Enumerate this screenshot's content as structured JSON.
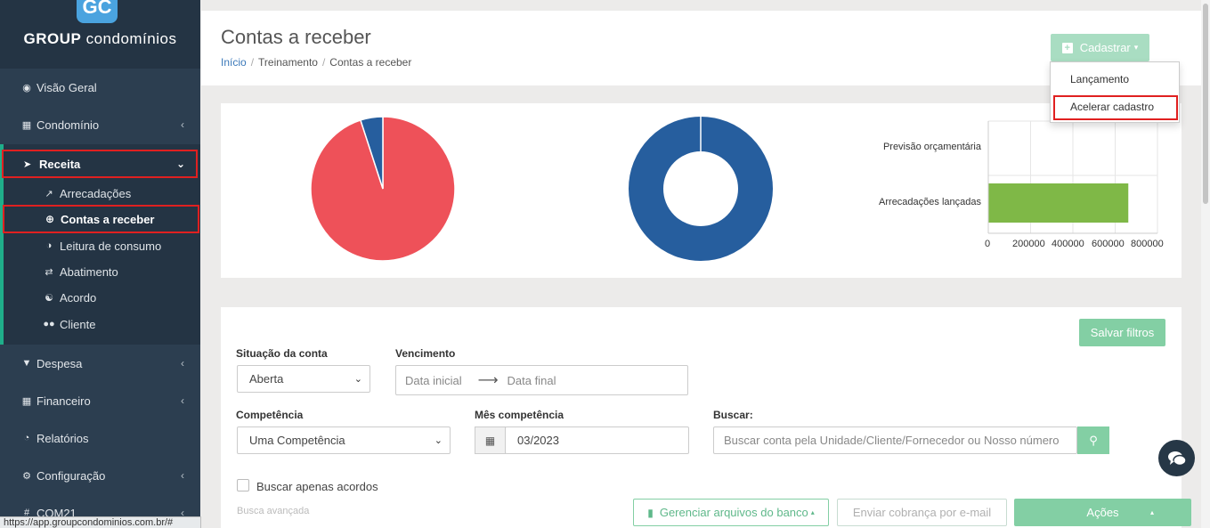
{
  "brand": {
    "logo_letters": "GC",
    "name_bold": "GROUP",
    "name_rest": " condomínios"
  },
  "sidebar": {
    "items": [
      {
        "label": "Visão Geral",
        "icon": "dashboard-icon"
      },
      {
        "label": "Condomínio",
        "icon": "building-icon"
      },
      {
        "label": "Receita",
        "icon": "arrow-up-circle-icon"
      },
      {
        "label": "Despesa",
        "icon": "arrow-down-circle-icon"
      },
      {
        "label": "Financeiro",
        "icon": "calculator-icon"
      },
      {
        "label": "Relatórios",
        "icon": "pie-chart-icon"
      },
      {
        "label": "Configuração",
        "icon": "gear-icon"
      },
      {
        "label": "COM21",
        "icon": "hashtag-icon"
      }
    ],
    "receita_sub": [
      {
        "label": "Arrecadações",
        "icon": "line-chart-icon"
      },
      {
        "label": "Contas a receber",
        "icon": "plus-circle-icon"
      },
      {
        "label": "Leitura de consumo",
        "icon": "gauge-icon"
      },
      {
        "label": "Abatimento",
        "icon": "exchange-icon"
      },
      {
        "label": "Acordo",
        "icon": "handshake-icon"
      },
      {
        "label": "Cliente",
        "icon": "users-icon"
      }
    ]
  },
  "status_url": "https://app.groupcondominios.com.br/#",
  "header": {
    "title": "Contas a receber",
    "breadcrumb": [
      "Início",
      "Treinamento",
      "Contas a receber"
    ],
    "cadastrar_label": "Cadastrar",
    "dropdown": [
      "Lançamento",
      "Acelerar cadastro"
    ]
  },
  "charts": {
    "bar_labels": [
      "Previsão orçamentária",
      "Arrecadações lançadas"
    ],
    "bar_ticks": [
      "0",
      "200000",
      "400000",
      "600000",
      "800000"
    ]
  },
  "chart_data": [
    {
      "type": "pie",
      "values": [
        95,
        5
      ],
      "colors": [
        "#ee5159",
        "#265e9e"
      ]
    },
    {
      "type": "pie",
      "values": [
        100
      ],
      "colors": [
        "#265e9e"
      ]
    },
    {
      "type": "bar",
      "orientation": "horizontal",
      "categories": [
        "Previsão orçamentária",
        "Arrecadações lançadas"
      ],
      "values": [
        0,
        660000
      ],
      "xlim": [
        0,
        800000
      ],
      "colors": [
        "#7fb847"
      ]
    }
  ],
  "filters": {
    "save_label": "Salvar filtros",
    "situacao": {
      "label": "Situação da conta",
      "value": "Aberta"
    },
    "vencimento": {
      "label": "Vencimento",
      "start_placeholder": "Data inicial",
      "end_placeholder": "Data final"
    },
    "competencia": {
      "label": "Competência",
      "value": "Uma Competência"
    },
    "mes": {
      "label": "Mês competência",
      "value": "03/2023"
    },
    "buscar": {
      "label": "Buscar:",
      "placeholder": "Buscar conta pela Unidade/Cliente/Fornecedor ou Nosso número"
    },
    "acordos_label": "Buscar apenas acordos",
    "advanced_label": "Busca avançada"
  },
  "bottom": {
    "gerenciar": "Gerenciar arquivos do banco",
    "enviar": "Enviar cobrança por e-mail",
    "acoes": "Ações"
  }
}
